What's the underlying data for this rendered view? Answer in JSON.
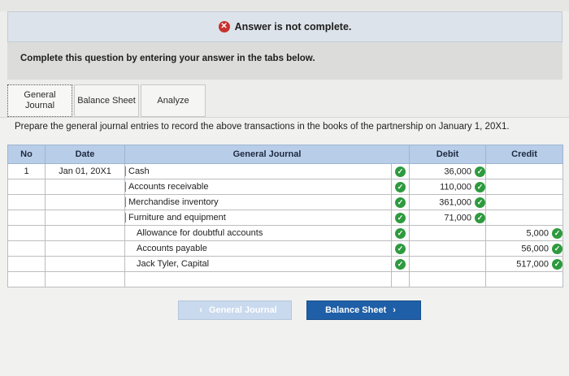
{
  "banner": {
    "text": "Answer is not complete.",
    "icon": "x-circle-icon"
  },
  "instruction": "Complete this question by entering your answer in the tabs below.",
  "tabs": [
    {
      "label": "General Journal",
      "active": true
    },
    {
      "label": "Balance Sheet",
      "active": false
    },
    {
      "label": "Analyze",
      "active": false
    }
  ],
  "prompt": "Prepare the general journal entries to record the above transactions in the books of the partnership on January 1, 20X1.",
  "table": {
    "headers": {
      "no": "No",
      "date": "Date",
      "journal": "General Journal",
      "debit": "Debit",
      "credit": "Credit"
    },
    "rows": [
      {
        "no": "1",
        "date": "Jan 01, 20X1",
        "account": "Cash",
        "debit": "36,000",
        "credit": "",
        "indent": false
      },
      {
        "no": "",
        "date": "",
        "account": "Accounts receivable",
        "debit": "110,000",
        "credit": "",
        "indent": false
      },
      {
        "no": "",
        "date": "",
        "account": "Merchandise inventory",
        "debit": "361,000",
        "credit": "",
        "indent": false
      },
      {
        "no": "",
        "date": "",
        "account": "Furniture and equipment",
        "debit": "71,000",
        "credit": "",
        "indent": false
      },
      {
        "no": "",
        "date": "",
        "account": "Allowance for doubtful accounts",
        "debit": "",
        "credit": "5,000",
        "indent": true
      },
      {
        "no": "",
        "date": "",
        "account": "Accounts payable",
        "debit": "",
        "credit": "56,000",
        "indent": true
      },
      {
        "no": "",
        "date": "",
        "account": "Jack Tyler, Capital",
        "debit": "",
        "credit": "517,000",
        "indent": true
      },
      {
        "no": "",
        "date": "",
        "account": "",
        "debit": "",
        "credit": "",
        "indent": false
      }
    ]
  },
  "nav": {
    "prev_label": "General Journal",
    "next_label": "Balance Sheet"
  },
  "colors": {
    "header_bg": "#b8cde8",
    "next_btn": "#1f5fa7",
    "check": "#2e9a3e",
    "error": "#c8312f"
  }
}
